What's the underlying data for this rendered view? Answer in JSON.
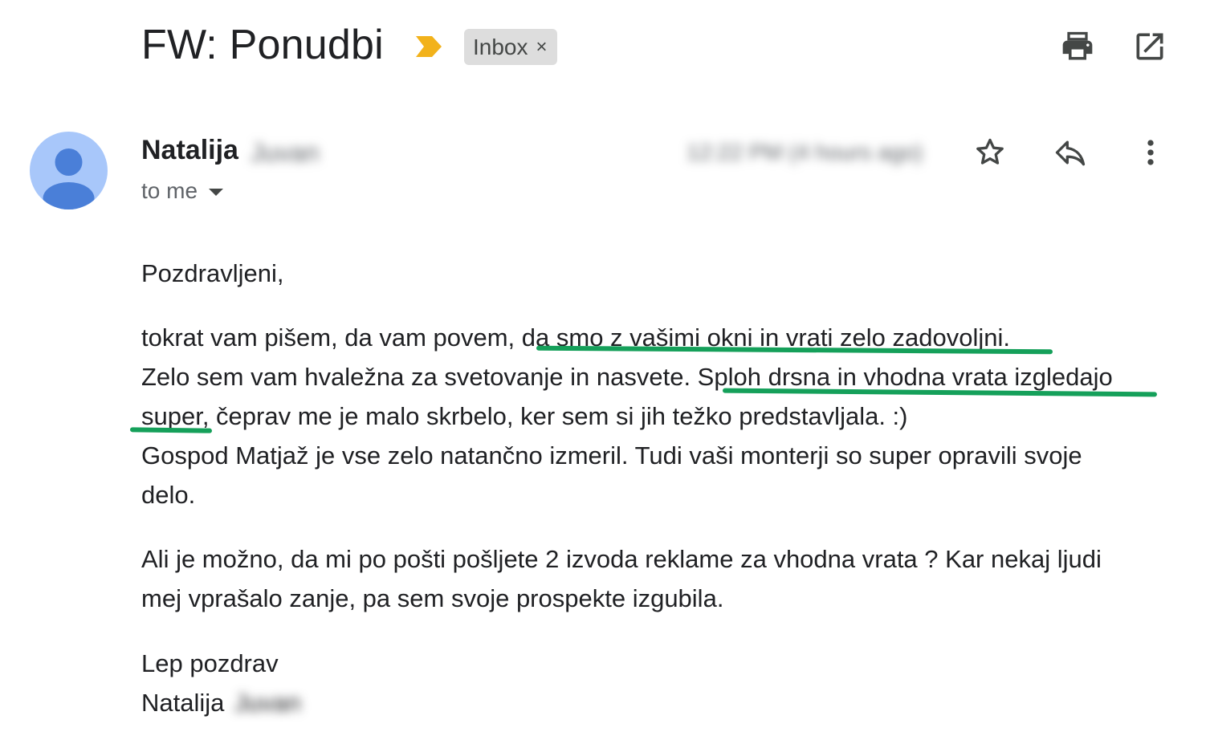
{
  "header": {
    "subject": "FW: Ponudbi",
    "label": "Inbox",
    "label_close": "×",
    "importance_color": "#f2b21b"
  },
  "toolbar": {
    "print_icon": "print-icon",
    "popout_icon": "open-in-new-window-icon"
  },
  "message": {
    "sender_first": "Natalija",
    "sender_last": "Juvan",
    "timestamp": "12:22 PM (4 hours ago)",
    "recipient": "to me",
    "actions": [
      "star-icon",
      "reply-icon",
      "more-vert-icon"
    ]
  },
  "body": {
    "greeting": "Pozdravljeni,",
    "lines": [
      "tokrat vam pišem, da vam povem, da smo z vašimi okni in vrati zelo zadovoljni.",
      "Zelo sem vam hvaležna za svetovanje in nasvete. Sploh drsna in vhodna vrata izgledajo",
      "super, čeprav me je malo skrbelo, ker sem si jih težko predstavljala. :)",
      "Gospod Matjaž je vse zelo natančno izmeril. Tudi vaši monterji so super opravili svoje",
      "delo."
    ],
    "question_lines": [
      "Ali je možno, da mi po pošti pošljete 2 izvoda reklame za vhodna vrata ? Kar nekaj ljudi",
      "mej vprašalo zanje, pa sem svoje prospekte izgubila."
    ],
    "closing": "Lep pozdrav",
    "signature_first": "Natalija",
    "signature_last": "Juvan",
    "highlight_color": "#15a05a"
  }
}
